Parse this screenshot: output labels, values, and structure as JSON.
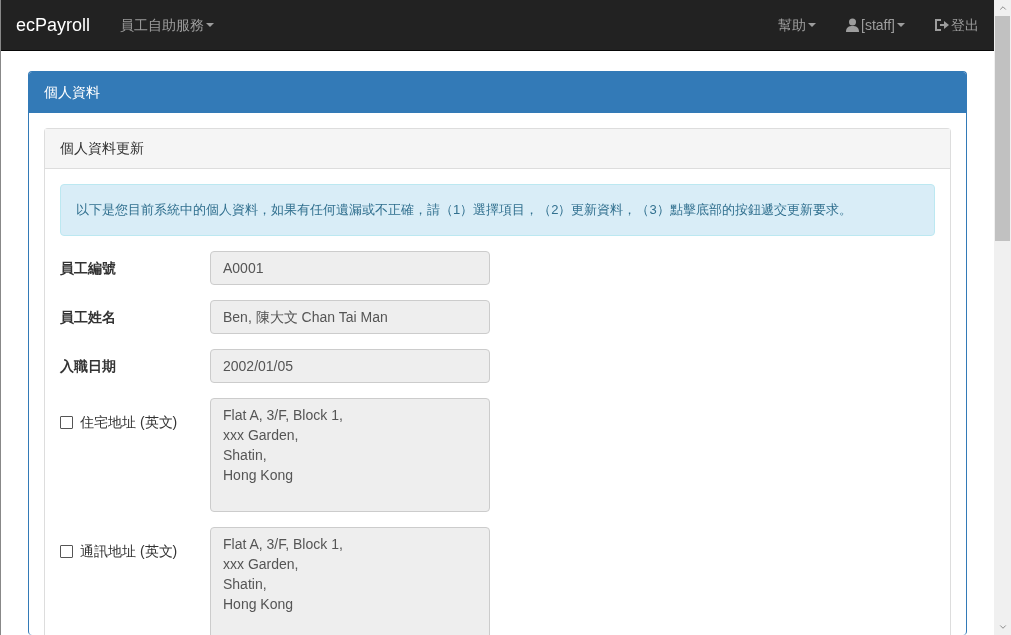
{
  "navbar": {
    "brand": "ecPayroll",
    "left_menus": [
      {
        "label": "員工自助服務",
        "kind": "dropdown"
      }
    ],
    "right_menus": [
      {
        "label": "幫助",
        "kind": "dropdown"
      },
      {
        "label": "[staff]",
        "kind": "user"
      },
      {
        "label": "登出",
        "kind": "logout"
      }
    ]
  },
  "panel": {
    "title": "個人資料",
    "inner_panel": {
      "title": "個人資料更新",
      "alert": "以下是您目前系統中的個人資料，如果有任何遺漏或不正確，請（1）選擇項目，（2）更新資料，（3）點擊底部的按鈕遞交更新要求。",
      "fields": [
        {
          "kind": "input",
          "label": "員工編號",
          "value": "A0001"
        },
        {
          "kind": "input",
          "label": "員工姓名",
          "value": "Ben, 陳大文 Chan Tai Man"
        },
        {
          "kind": "input",
          "label": "入職日期",
          "value": "2002/01/05"
        },
        {
          "kind": "textarea",
          "label": "住宅地址 (英文)",
          "checked": false,
          "value": "Flat A, 3/F, Block 1,\nxxx Garden,\nShatin,\nHong Kong"
        },
        {
          "kind": "textarea",
          "label": "通訊地址 (英文)",
          "checked": false,
          "value": "Flat A, 3/F, Block 1,\nxxx Garden,\nShatin,\nHong Kong"
        }
      ]
    }
  }
}
